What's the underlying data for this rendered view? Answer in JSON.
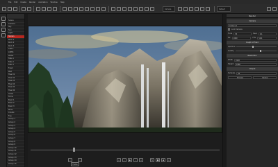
{
  "menu": {
    "items": [
      "File",
      "Edit",
      "Create",
      "Render",
      "Animation",
      "Window",
      "Help"
    ]
  },
  "toolbar": {
    "view_mode": "Camera",
    "render_mode": "Default"
  },
  "scene_tree": {
    "items": [
      "Scene",
      "Camera",
      "Sky",
      "Sun",
      "Light",
      "Terrain",
      "Rock 1",
      "Rock 2",
      "Rock 3",
      "Cliff A",
      "Cliff B",
      "Water",
      "Falls 1",
      "Falls 2",
      "Falls 3",
      "Foam",
      "Mist",
      "Tree 01",
      "Tree 02",
      "Tree 03",
      "Tree 04",
      "Tree 05",
      "Tree 06",
      "Grass",
      "Ferns",
      "Bush 1",
      "Bush 2",
      "Bush 3",
      "Moss",
      "Clouds",
      "Fog",
      "Group 1",
      "Group 2",
      "Group 3",
      "Group 4",
      "Group 5",
      "Group 6",
      "Group 7",
      "Group 8",
      "Group 9",
      "Group 10",
      "Group 11",
      "Group 12",
      "Group 13",
      "Group 14",
      "Group 15"
    ],
    "selected_index": 5
  },
  "timeline": {
    "playhead": 0.23,
    "frame_label": "Frame"
  },
  "right_panel": {
    "title": "Render",
    "sections": {
      "camera": "Camera",
      "light": "Depth of Field",
      "render": "Resolution",
      "output": "Output"
    },
    "fields": {
      "camera_name": "Camera 1",
      "lock_label": "Lock Camera",
      "focal_label": "Focal",
      "focal_value": "35",
      "near_label": "Near",
      "near_value": "0.1",
      "far_label": "Far",
      "far_value": "1000",
      "fov_label": "FOV",
      "fov_value": "54.4",
      "aperture_label": "Aperture",
      "width_label": "Width",
      "width_value": "1920",
      "height_label": "Height",
      "height_value": "1080",
      "samples_label": "Samples",
      "samples_value": "64",
      "quality_label": "Quality"
    },
    "buttons": {
      "render": "Render",
      "preview": "Preview"
    }
  }
}
